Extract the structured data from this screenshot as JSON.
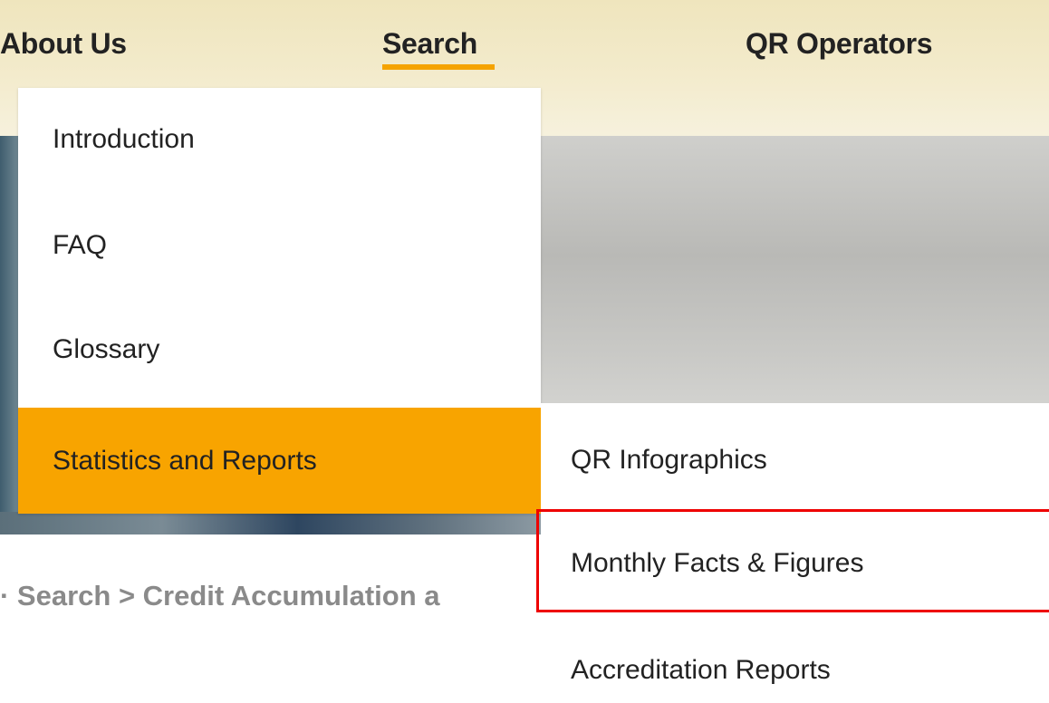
{
  "nav": {
    "items": [
      {
        "label": "About Us"
      },
      {
        "label": "Search"
      },
      {
        "label": "QR Operators"
      }
    ],
    "active_item": "Search",
    "accent_color": "#f5a300"
  },
  "dropdown": {
    "items": [
      {
        "label": "Introduction"
      },
      {
        "label": "FAQ"
      },
      {
        "label": "Glossary"
      },
      {
        "label": "Statistics and Reports"
      }
    ],
    "active_item": "Statistics and Reports",
    "active_color": "#f8a400"
  },
  "submenu": {
    "items": [
      {
        "label": "QR Infographics"
      },
      {
        "label": "Monthly Facts & Figures"
      },
      {
        "label": "Accreditation Reports"
      }
    ],
    "highlighted_item": "Monthly Facts & Figures",
    "highlight_color": "#ee0000"
  },
  "breadcrumb": {
    "text": "· Search > Credit Accumulation a"
  }
}
